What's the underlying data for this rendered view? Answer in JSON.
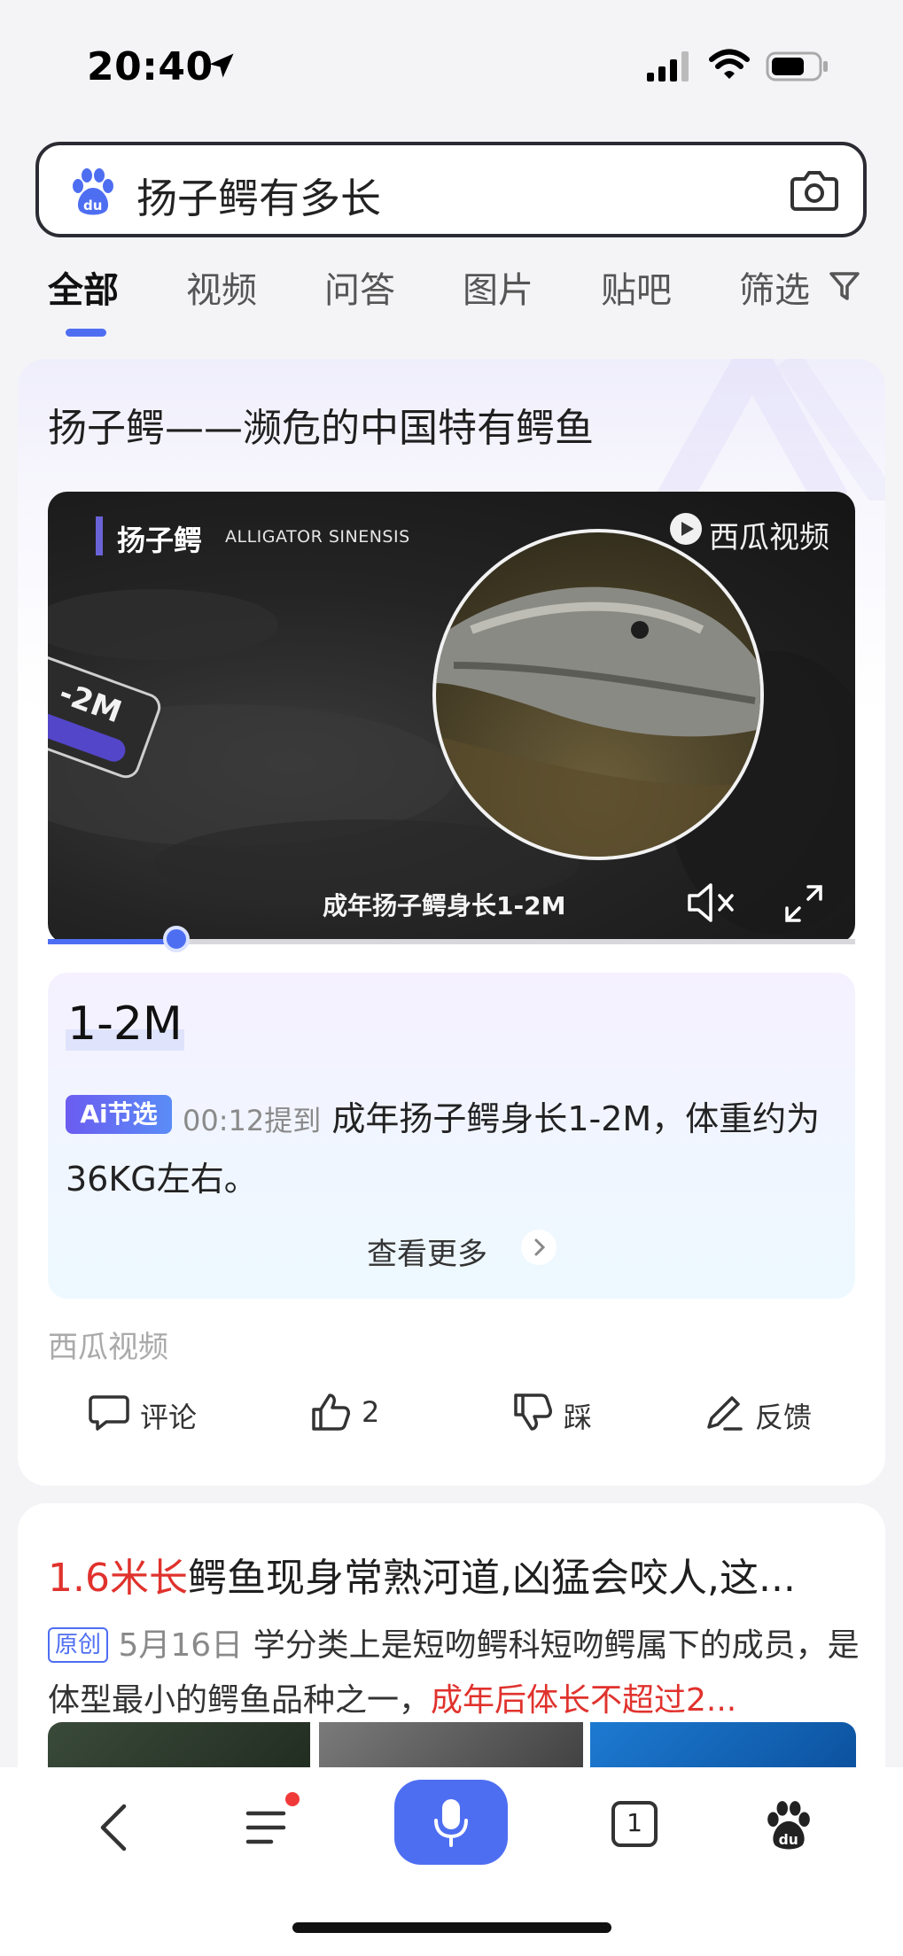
{
  "status_bar": {
    "time": "20:40"
  },
  "search": {
    "query": "扬子鳄有多长"
  },
  "tabs": [
    {
      "label": "全部"
    },
    {
      "label": "视频"
    },
    {
      "label": "问答"
    },
    {
      "label": "图片"
    },
    {
      "label": "贴吧"
    },
    {
      "label": "筛选"
    }
  ],
  "result1": {
    "title": "扬子鳄——濒危的中国特有鳄鱼",
    "video": {
      "name": "扬子鳄",
      "name_en": "ALLIGATOR SINENSIS",
      "brand": "西瓜视频",
      "tag_text": "-2M",
      "caption": "成年扬子鳄身长1-2M"
    },
    "answer": {
      "big": "1-2M",
      "badge": "Ai节选",
      "timestamp": "00:12提到",
      "text": "成年扬子鳄身长1-2M，体重约为36KG左右。",
      "see_more": "查看更多"
    },
    "source": "西瓜视频",
    "actions": {
      "comment": "评论",
      "like_count": "2",
      "dislike": "踩",
      "feedback": "反馈"
    }
  },
  "result2": {
    "title_highlight": "1.6米长",
    "title_rest": "鳄鱼现身常熟河道,凶猛会咬人,这...",
    "badge": "原创",
    "date": "5月16日",
    "snippet": "学分类上是短吻鳄科短吻鳄属下的成员，是体型最小的鳄鱼品种之一，",
    "snippet_highlight": "成年后体长不超过2..."
  },
  "bottom_nav": {
    "tab_count": "1"
  },
  "colors": {
    "accent": "#4e6ef2",
    "highlight_red": "#e0322d"
  }
}
